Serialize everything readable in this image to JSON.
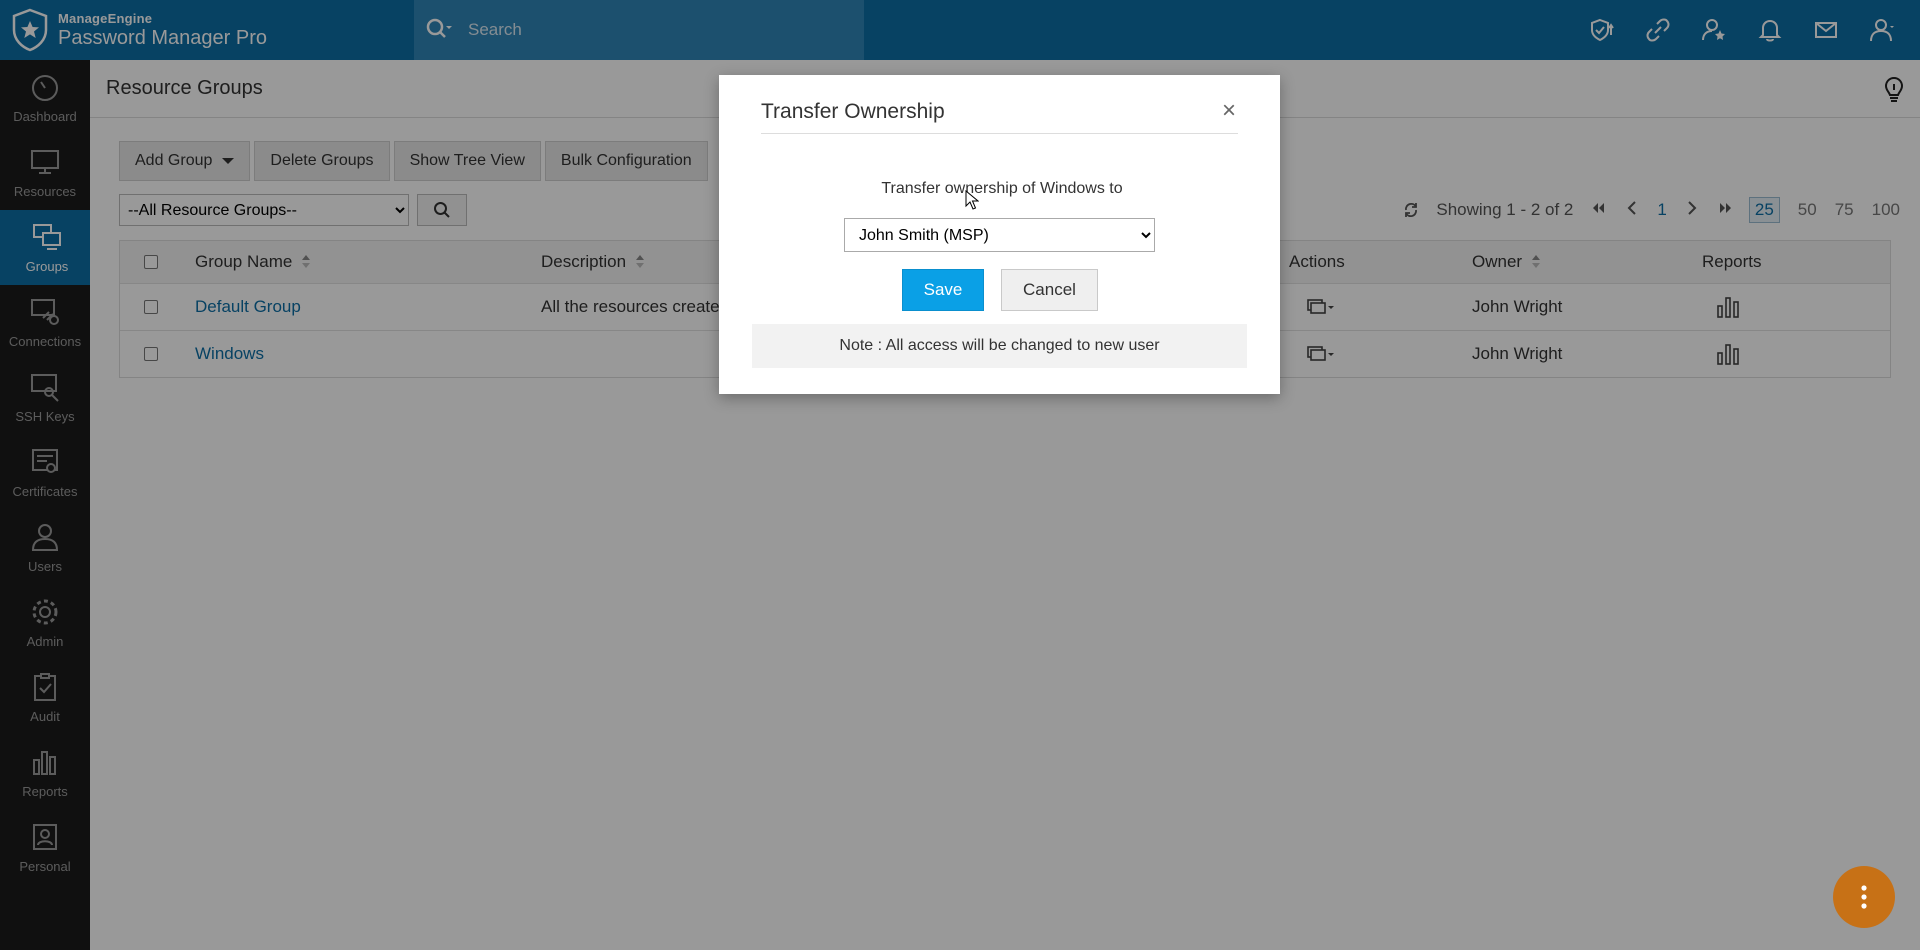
{
  "app": {
    "brand": "ManageEngine",
    "product": "Password Manager Pro"
  },
  "search": {
    "placeholder": "Search"
  },
  "topbar_icons": [
    "shield-upgrade-icon",
    "link-icon",
    "user-star-icon",
    "bell-icon",
    "mail-icon",
    "user-icon"
  ],
  "sidebar": {
    "items": [
      {
        "label": "Dashboard",
        "icon": "gauge-icon"
      },
      {
        "label": "Resources",
        "icon": "monitor-icon"
      },
      {
        "label": "Groups",
        "icon": "groups-icon",
        "active": true
      },
      {
        "label": "Connections",
        "icon": "connections-icon"
      },
      {
        "label": "SSH Keys",
        "icon": "ssh-key-icon"
      },
      {
        "label": "Certificates",
        "icon": "certificate-icon"
      },
      {
        "label": "Users",
        "icon": "user-icon"
      },
      {
        "label": "Admin",
        "icon": "gear-icon"
      },
      {
        "label": "Audit",
        "icon": "clipboard-icon"
      },
      {
        "label": "Reports",
        "icon": "bar-chart-icon"
      },
      {
        "label": "Personal",
        "icon": "personal-icon"
      }
    ]
  },
  "page": {
    "title": "Resource Groups"
  },
  "toolbar": {
    "add_group": "Add Group",
    "delete_groups": "Delete Groups",
    "show_tree_view": "Show Tree View",
    "bulk_configuration": "Bulk Configuration"
  },
  "filter": {
    "selected": "--All Resource Groups--"
  },
  "pager": {
    "showing": "Showing 1 - 2 of 2",
    "current_page": "1",
    "sizes": [
      "25",
      "50",
      "75",
      "100"
    ],
    "selected_size": "25"
  },
  "table": {
    "headers": {
      "group_name": "Group Name",
      "description": "Description",
      "actions": "Actions",
      "owner": "Owner",
      "reports": "Reports"
    },
    "rows": [
      {
        "group_name": "Default Group",
        "description": "All the resources create",
        "owner": "John Wright"
      },
      {
        "group_name": "Windows",
        "description": "",
        "owner": "John Wright"
      }
    ]
  },
  "modal": {
    "title": "Transfer Ownership",
    "close": "×",
    "prompt": "Transfer ownership of Windows to",
    "selected_user": "John Smith (MSP)",
    "save": "Save",
    "cancel": "Cancel",
    "note": "Note : All access will be changed to new user"
  },
  "colors": {
    "brand_blue": "#0d6ea6",
    "save_blue": "#0aa0e6",
    "sidebar_bg": "#1c1c1c",
    "fab_orange": "#c77116"
  }
}
